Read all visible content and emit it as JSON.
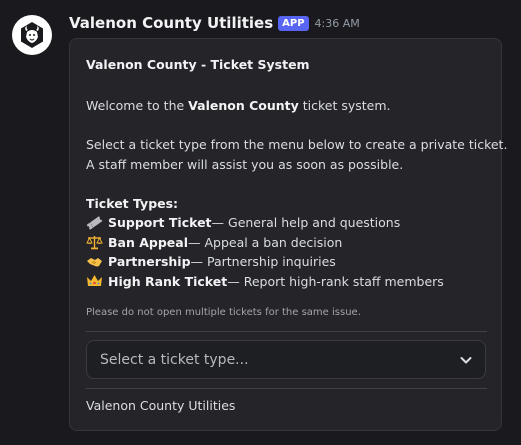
{
  "message": {
    "author": "Valenon County Utilities",
    "app_tag": "APP",
    "timestamp": "4:36 AM",
    "avatar_icon": "bison-logo-icon"
  },
  "embed": {
    "title": "Valenon County - Ticket System",
    "welcome_prefix": "Welcome to the ",
    "welcome_bold": "Valenon County",
    "welcome_suffix": " ticket system.",
    "instructions_line1": "Select a ticket type from the menu below to create a private ticket.",
    "instructions_line2": "A staff member will assist you as soon as possible.",
    "types_heading": "Ticket Types:",
    "ticket_types": [
      {
        "icon": "ticket-icon",
        "name": "Support Ticket",
        "description": " — General help and questions"
      },
      {
        "icon": "scales-icon",
        "name": "Ban Appeal",
        "description": " — Appeal a ban decision"
      },
      {
        "icon": "handshake-icon",
        "name": "Partnership",
        "description": " — Partnership inquiries"
      },
      {
        "icon": "crown-icon",
        "name": "High Rank Ticket",
        "description": " — Report high-rank staff members"
      }
    ],
    "note": "Please do not open multiple tickets for the same issue.",
    "select_placeholder": "Select a ticket type...",
    "footer": "Valenon County Utilities"
  },
  "colors": {
    "background": "#1a1a1e",
    "embed_background": "#242429",
    "app_tag": "#5865f2"
  }
}
